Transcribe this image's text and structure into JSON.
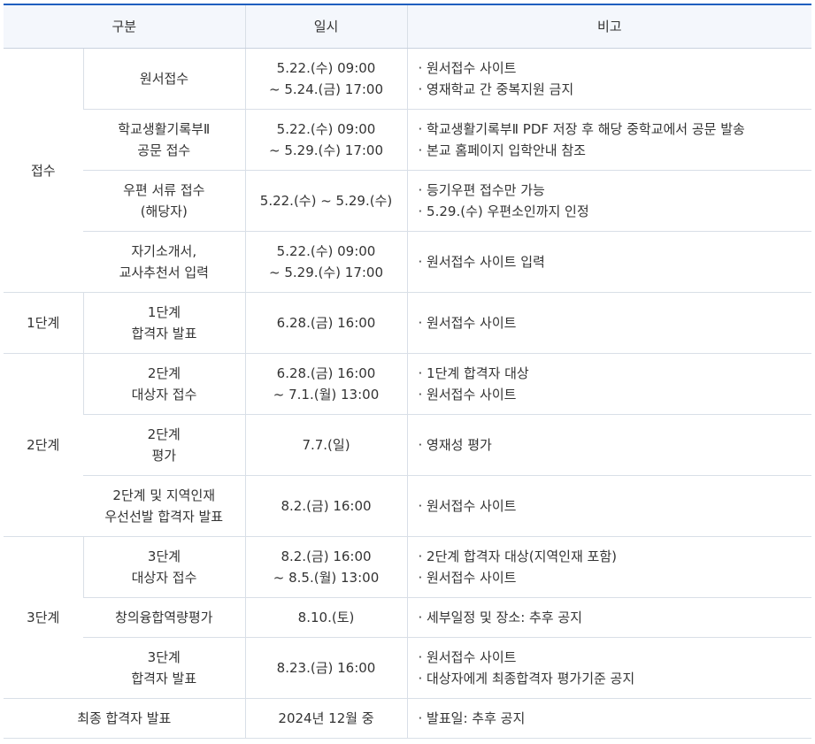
{
  "header": [
    "구분",
    "일시",
    "비고"
  ],
  "rows": {
    "apply_app": {
      "group": "접수",
      "item": [
        "원서접수"
      ],
      "date": [
        "5.22.(수) 09:00",
        "~ 5.24.(금) 17:00"
      ],
      "notes": [
        "· 원서접수 사이트",
        "· 영재학교 간 중복지원 금지"
      ]
    },
    "apply_record": {
      "item": [
        "학교생활기록부Ⅱ",
        "공문 접수"
      ],
      "date": [
        "5.22.(수) 09:00",
        "~ 5.29.(수) 17:00"
      ],
      "notes": [
        "· 학교생활기록부Ⅱ PDF 저장 후 해당 중학교에서 공문 발송",
        "· 본교 홈페이지 입학안내 참조"
      ]
    },
    "apply_mail": {
      "item": [
        "우편 서류 접수",
        "(해당자)"
      ],
      "date": [
        "5.22.(수) ~ 5.29.(수)"
      ],
      "notes": [
        "· 등기우편 접수만 가능",
        "· 5.29.(수) 우편소인까지 인정"
      ]
    },
    "apply_intro": {
      "item": [
        "자기소개서,",
        "교사추천서 입력"
      ],
      "date": [
        "5.22.(수) 09:00",
        "~ 5.29.(수) 17:00"
      ],
      "notes": [
        "· 원서접수 사이트 입력"
      ]
    },
    "stage1": {
      "group": "1단계",
      "item": [
        "1단계",
        "합격자 발표"
      ],
      "date": [
        "6.28.(금) 16:00"
      ],
      "notes": [
        "· 원서접수 사이트"
      ]
    },
    "stage2_apply": {
      "group": "2단계",
      "item": [
        "2단계",
        "대상자 접수"
      ],
      "date": [
        "6.28.(금) 16:00",
        "~ 7.1.(월) 13:00"
      ],
      "notes": [
        "· 1단계 합격자 대상",
        "· 원서접수 사이트"
      ]
    },
    "stage2_eval": {
      "item": [
        "2단계",
        "평가"
      ],
      "date": [
        "7.7.(일)"
      ],
      "notes": [
        "· 영재성 평가"
      ]
    },
    "stage2_result": {
      "item": [
        "2단계 및 지역인재",
        "우선선발 합격자 발표"
      ],
      "date": [
        "8.2.(금) 16:00"
      ],
      "notes": [
        "· 원서접수 사이트"
      ]
    },
    "stage3_apply": {
      "group": "3단계",
      "item": [
        "3단계",
        "대상자 접수"
      ],
      "date": [
        "8.2.(금) 16:00",
        "~ 8.5.(월) 13:00"
      ],
      "notes": [
        "· 2단계 합격자 대상(지역인재 포함)",
        "· 원서접수 사이트"
      ]
    },
    "stage3_eval": {
      "item": [
        "창의융합역량평가"
      ],
      "date": [
        "8.10.(토)"
      ],
      "notes": [
        "· 세부일정 및 장소: 추후 공지"
      ]
    },
    "stage3_result": {
      "item": [
        "3단계",
        "합격자 발표"
      ],
      "date": [
        "8.23.(금) 16:00"
      ],
      "notes": [
        "· 원서접수 사이트",
        "· 대상자에게 최종합격자 평가기준 공지"
      ]
    },
    "final": {
      "item": [
        "최종 합격자 발표"
      ],
      "date": [
        "2024년 12월 중"
      ],
      "notes": [
        "· 발표일: 추후 공지"
      ]
    }
  },
  "colors": {
    "accent": "#1f5fbf",
    "header_bg": "#f4f7fc",
    "border": "#d9dfe7",
    "text": "#333333"
  }
}
